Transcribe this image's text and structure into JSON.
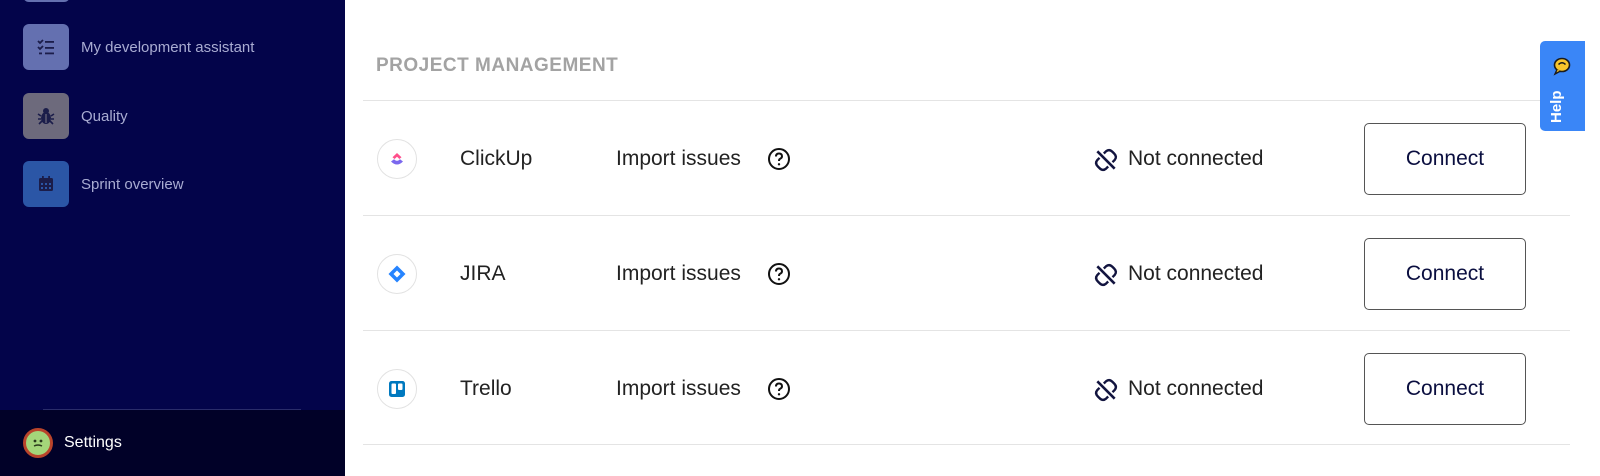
{
  "sidebar": {
    "items": [
      {
        "label": "My development assistant",
        "icon": "checklist-icon"
      },
      {
        "label": "Quality",
        "icon": "bug-icon"
      },
      {
        "label": "Sprint overview",
        "icon": "calendar-icon"
      }
    ],
    "settings_label": "Settings"
  },
  "main": {
    "section_title": "PROJECT MANAGEMENT",
    "integrations": [
      {
        "name": "ClickUp",
        "action": "Import issues",
        "status": "Not connected",
        "button": "Connect",
        "icon": "clickup-logo-icon"
      },
      {
        "name": "JIRA",
        "action": "Import issues",
        "status": "Not connected",
        "button": "Connect",
        "icon": "jira-logo-icon"
      },
      {
        "name": "Trello",
        "action": "Import issues",
        "status": "Not connected",
        "button": "Connect",
        "icon": "trello-logo-icon"
      }
    ]
  },
  "help_tab": {
    "label": "Help"
  },
  "colors": {
    "sidebar_bg": "#03044a",
    "settings_bg": "#010128",
    "help_tab": "#3a86f7",
    "jira_blue": "#2684ff",
    "trello_blue": "#0079bf"
  }
}
